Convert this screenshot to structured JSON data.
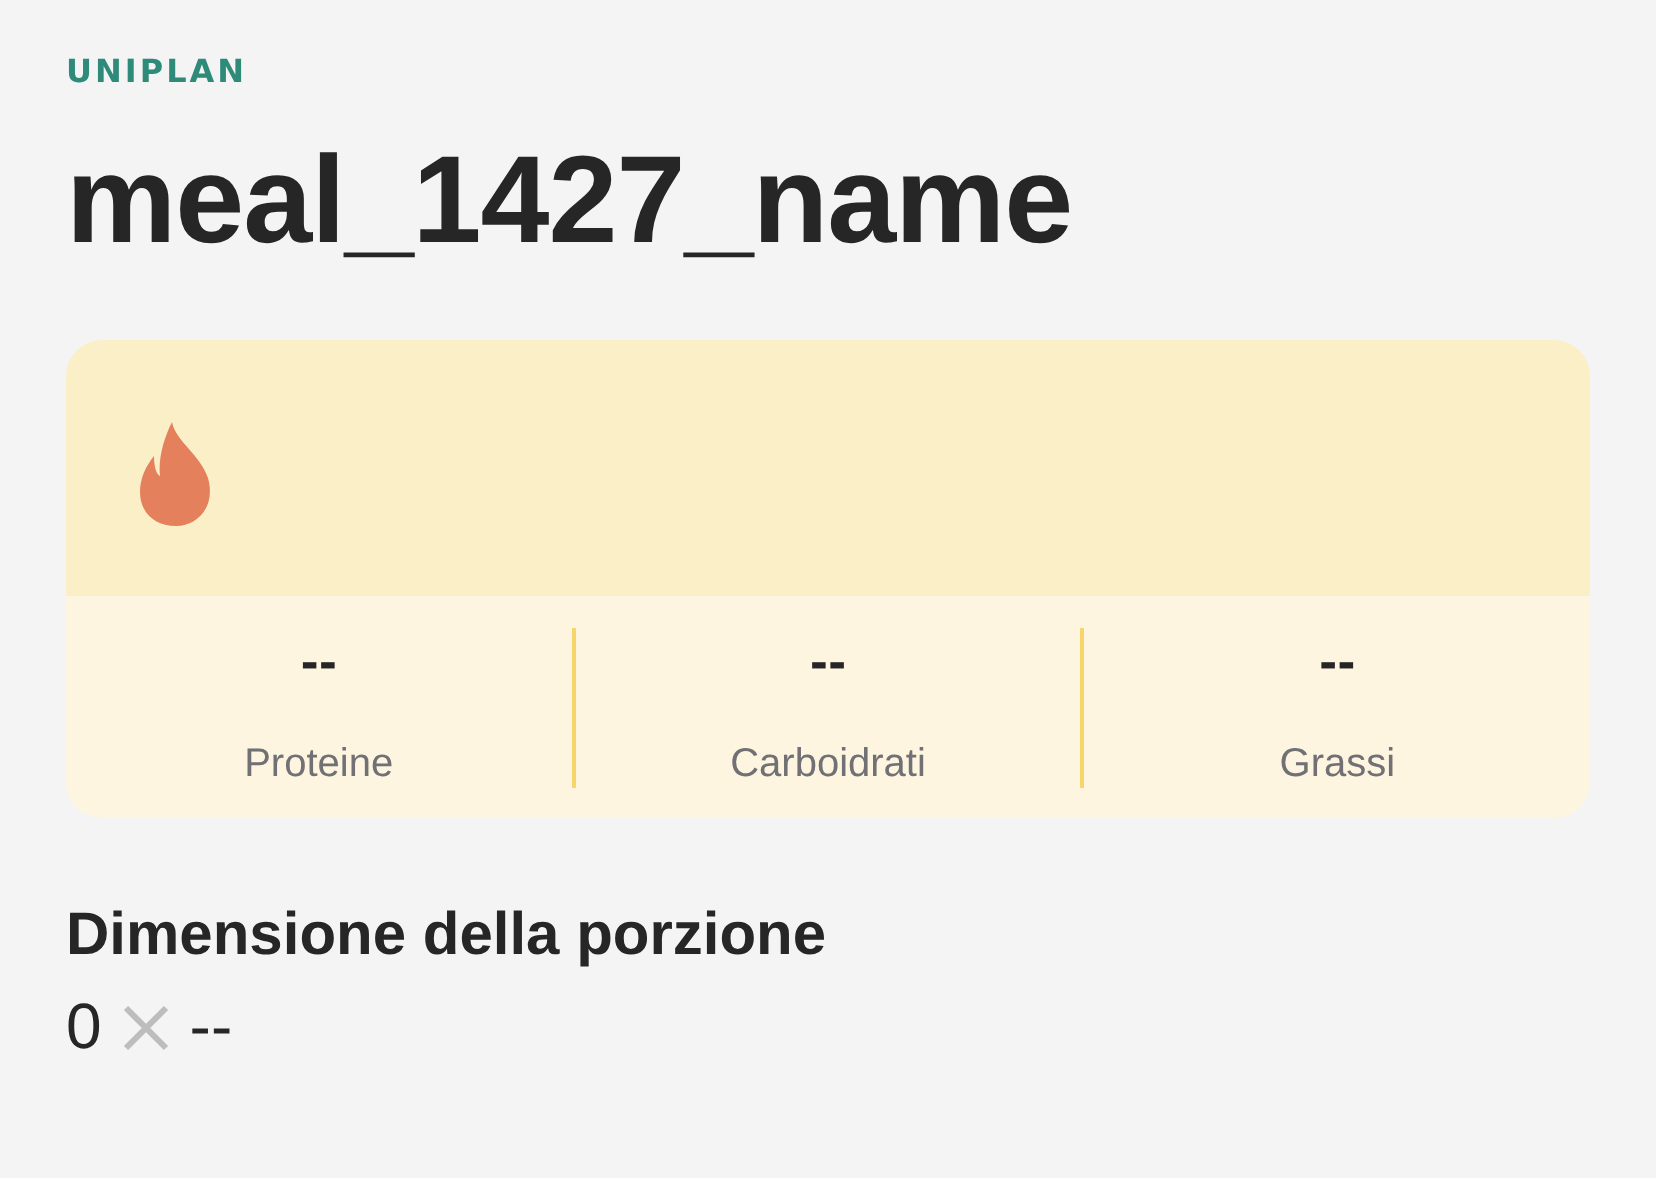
{
  "brand": "UNIPLAN",
  "title": "meal_1427_name",
  "macros": [
    {
      "value": "--",
      "label": "Proteine"
    },
    {
      "value": "--",
      "label": "Carboidrati"
    },
    {
      "value": "--",
      "label": "Grassi"
    }
  ],
  "serving": {
    "heading": "Dimensione della porzione",
    "quantity": "0",
    "unit": "--"
  }
}
